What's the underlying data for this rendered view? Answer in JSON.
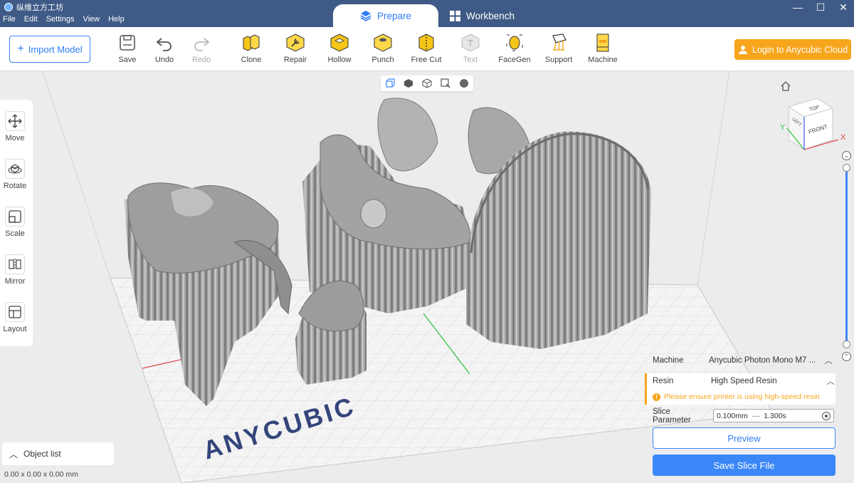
{
  "window": {
    "app_title": "纵维立方工坊",
    "menu": [
      "File",
      "Edit",
      "Settings",
      "View",
      "Help"
    ],
    "controls": [
      "—",
      "☐",
      "✕"
    ]
  },
  "modes": {
    "active": "Prepare",
    "inactive": "Workbench"
  },
  "toolbar": {
    "import_label": "Import Model",
    "tools": [
      {
        "label": "Save",
        "icon": "save-icon",
        "enabled": true
      },
      {
        "label": "Undo",
        "icon": "undo-icon",
        "enabled": true
      },
      {
        "label": "Redo",
        "icon": "redo-icon",
        "enabled": false
      },
      {
        "label": "Clone",
        "icon": "clone-icon",
        "enabled": true
      },
      {
        "label": "Repair",
        "icon": "repair-icon",
        "enabled": true
      },
      {
        "label": "Hollow",
        "icon": "hollow-icon",
        "enabled": true
      },
      {
        "label": "Punch",
        "icon": "punch-icon",
        "enabled": true
      },
      {
        "label": "Free Cut",
        "icon": "free-cut-icon",
        "enabled": true
      },
      {
        "label": "Text",
        "icon": "text-icon",
        "enabled": false
      },
      {
        "label": "FaceGen",
        "icon": "facegen-icon",
        "enabled": true
      },
      {
        "label": "Support",
        "icon": "support-icon",
        "enabled": true
      },
      {
        "label": "Machine",
        "icon": "machine-icon",
        "enabled": true
      }
    ],
    "login_label": "Login to Anycubic Cloud"
  },
  "left_panel": [
    {
      "label": "Move",
      "icon": "move-icon"
    },
    {
      "label": "Rotate",
      "icon": "rotate-icon"
    },
    {
      "label": "Scale",
      "icon": "scale-icon"
    },
    {
      "label": "Mirror",
      "icon": "mirror-icon"
    },
    {
      "label": "Layout",
      "icon": "layout-icon"
    }
  ],
  "object_list": {
    "label": "Object list",
    "dimensions": "0.00 x 0.00 x 0.00 mm"
  },
  "platform_logo": "ANYCUBIC",
  "view_cube": {
    "top": "TOP",
    "front": "FRONT",
    "left": "LEFT",
    "x": "X",
    "y": "Y"
  },
  "right_panel": {
    "machine_label": "Machine",
    "machine_value": "Anycubic Photon Mono M7 ...",
    "resin_label": "Resin",
    "resin_value": "High Speed Resin",
    "resin_warning": "Please ensure printer is using high-speed resin",
    "slice_label": "Slice Parameter",
    "layer_height": "0.100mm",
    "exposure": "1.300s",
    "preview_label": "Preview",
    "save_label": "Save Slice File"
  },
  "colors": {
    "titlebar": "#3f5a86",
    "accent_blue": "#3b87f7",
    "accent_orange": "#f7a51c",
    "model_gray": "#9a9a9a"
  }
}
